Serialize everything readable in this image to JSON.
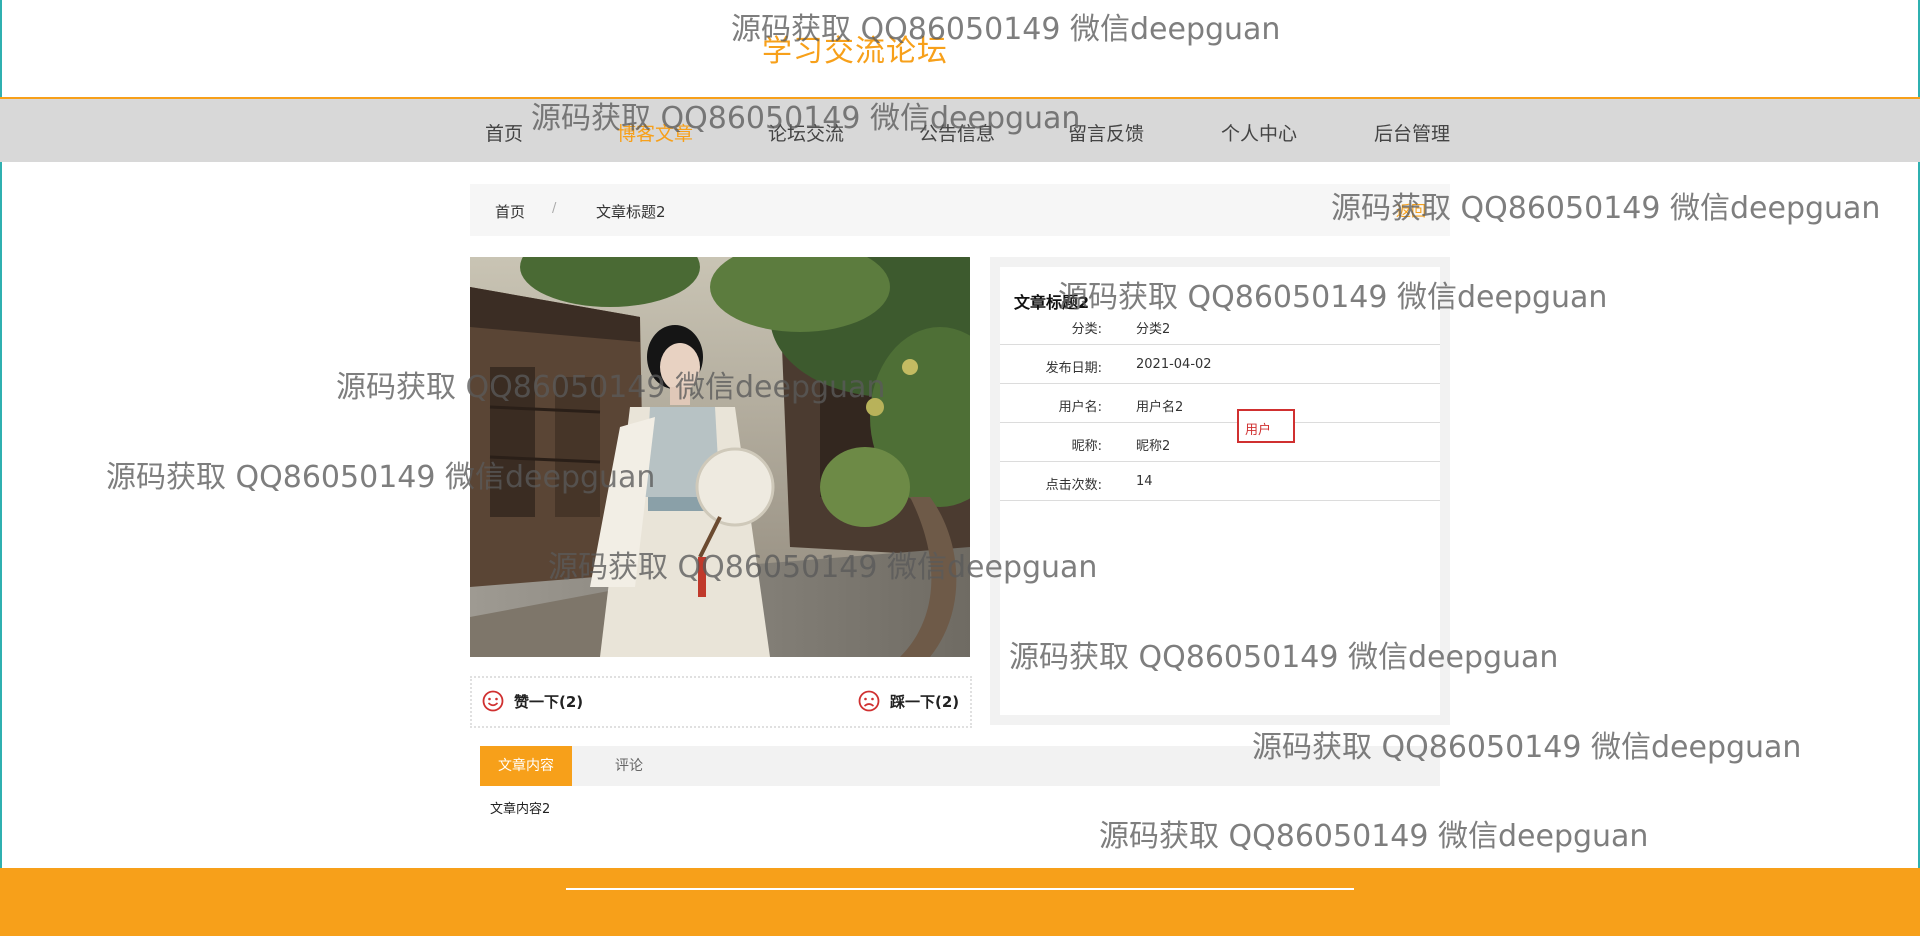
{
  "header": {
    "site_title": "学习交流论坛"
  },
  "nav": {
    "items": [
      "首页",
      "博客文章",
      "论坛交流",
      "公告信息",
      "留言反馈",
      "个人中心",
      "后台管理"
    ],
    "active_index": 1
  },
  "breadcrumb": {
    "home": "首页",
    "separator": "/",
    "current": "文章标题2",
    "back_label": "返回"
  },
  "votes": {
    "like_label": "赞一下(2)",
    "dislike_label": "踩一下(2)"
  },
  "detail": {
    "title": "文章标题2",
    "fields": [
      {
        "label": "分类:",
        "value": "分类2"
      },
      {
        "label": "发布日期:",
        "value": "2021-04-02"
      },
      {
        "label": "用户名:",
        "value": "用户名2"
      },
      {
        "label": "昵称:",
        "value": "昵称2"
      },
      {
        "label": "点击次数:",
        "value": "14"
      }
    ],
    "user_tag": "用户"
  },
  "tabs": {
    "content_tab": "文章内容",
    "comment_tab": "评论"
  },
  "content": {
    "text": "文章内容2"
  },
  "watermark": {
    "text": "源码获取 QQ86050149 微信deepguan"
  },
  "colors": {
    "accent": "#f7a01a",
    "nav_bg": "#d8d8d8",
    "tag_border": "#d03030"
  }
}
